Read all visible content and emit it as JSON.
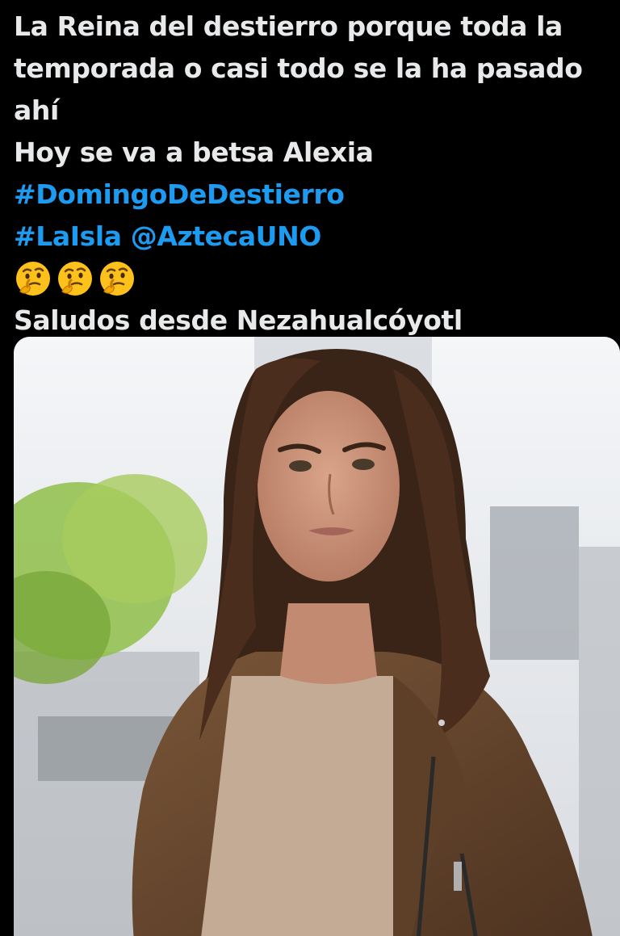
{
  "post": {
    "lines": [
      "La Reina del destierro porque toda la",
      "temporada o casi todo se la ha pasado",
      "ahí",
      "Hoy se va a betsa Alexia"
    ],
    "hashtag_1": "#DomingoDeDestierro",
    "hashtag_2": "#LaIsla",
    "mention": "@AztecaUNO",
    "emojis": [
      "thinking-face",
      "thinking-face",
      "thinking-face"
    ],
    "closing_line": "Saludos desde Nezahualcóyotl"
  },
  "colors": {
    "background": "#000000",
    "text": "#e7e9ea",
    "link": "#1d9bf0"
  },
  "media": {
    "kind": "photo"
  }
}
